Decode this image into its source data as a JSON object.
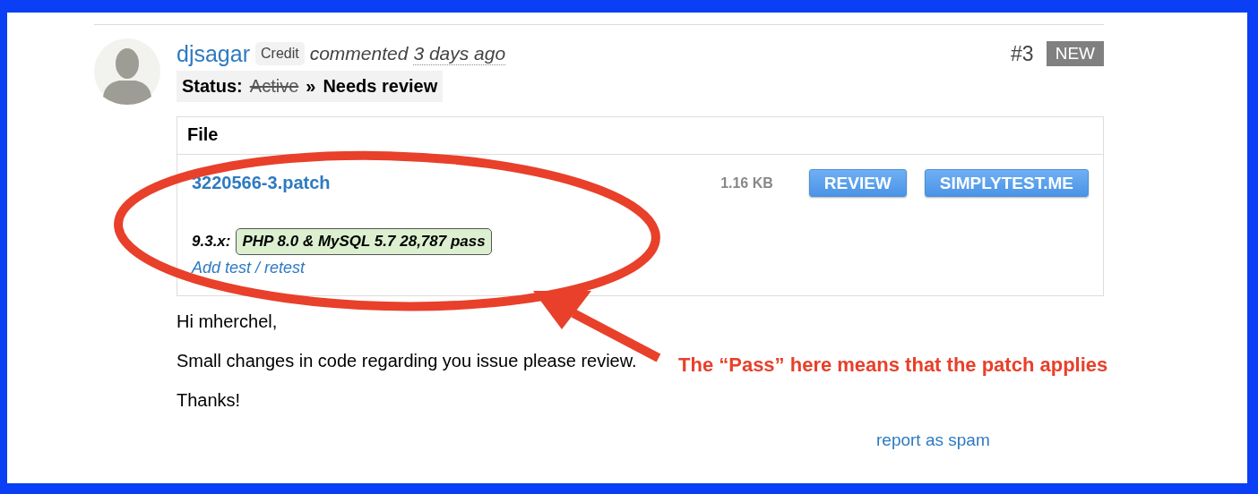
{
  "comment": {
    "author": "djsagar",
    "credit_badge": "Credit",
    "action": "commented",
    "time": "3 days ago",
    "number": "#3",
    "new_badge": "NEW",
    "status": {
      "label": "Status:",
      "from": "Active",
      "separator": "»",
      "to": "Needs review"
    }
  },
  "files": {
    "heading": "File",
    "items": [
      {
        "name": "3220566-3.patch",
        "size": "1.16 KB",
        "buttons": [
          "REVIEW",
          "SIMPLYTEST.ME"
        ],
        "tests": [
          {
            "branch": "9.3.x:",
            "result": "PHP 8.0 & MySQL 5.7 28,787 pass",
            "passed": true
          }
        ],
        "retest_link": "Add test / retest"
      }
    ]
  },
  "body": [
    "Hi mherchel,",
    "Small changes in code regarding you issue please review.",
    "Thanks!"
  ],
  "report_link": "report as spam",
  "annotation": {
    "text": "The “Pass” here means that the patch applies"
  }
}
